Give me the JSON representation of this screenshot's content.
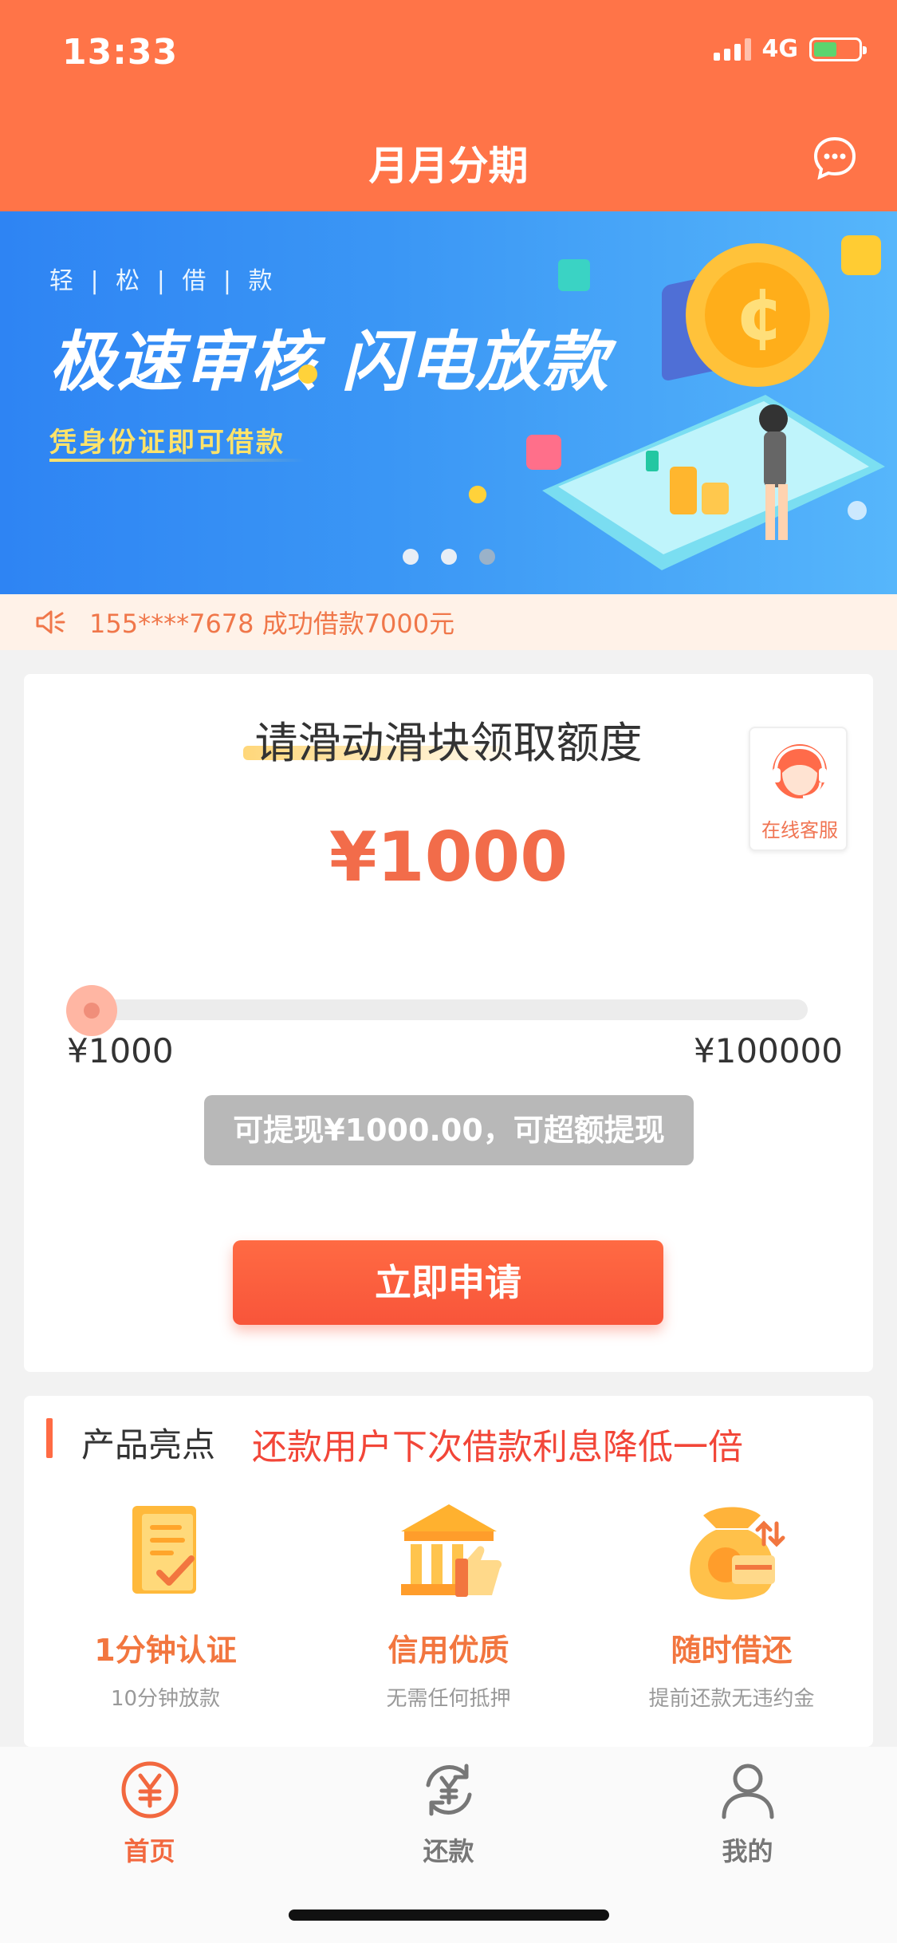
{
  "status_bar": {
    "time": "13:33",
    "network": "4G"
  },
  "header": {
    "title": "月月分期",
    "message_icon": "message-bubble-icon"
  },
  "banner": {
    "tag": "轻 | 松 | 借 | 款",
    "headline": "极速审核 闪电放款",
    "subline": "凭身份证即可借款",
    "slides": 3,
    "active_slide": 2
  },
  "notice": {
    "icon": "speaker-icon",
    "text": "155****7678 成功借款7000元"
  },
  "limit_card": {
    "title": "请滑动滑块领取额度",
    "service_label": "在线客服",
    "amount": "¥1000",
    "slider": {
      "min_label": "¥1000",
      "max_label": "¥100000",
      "min": 1000,
      "max": 100000,
      "value": 1000
    },
    "hint": "可提现¥1000.00，可超额提现",
    "apply_label": "立即申请"
  },
  "highlights": {
    "heading": "产品亮点",
    "slogan": "还款用户下次借款利息降低一倍",
    "items": [
      {
        "icon": "document-check-icon",
        "title": "1分钟认证",
        "desc": "10分钟放款"
      },
      {
        "icon": "bank-thumb-icon",
        "title": "信用优质",
        "desc": "无需任何抵押"
      },
      {
        "icon": "money-bag-icon",
        "title": "随时借还",
        "desc": "提前还款无违约金"
      }
    ]
  },
  "tabbar": {
    "items": [
      {
        "icon": "yen-circle-icon",
        "label": "首页",
        "active": true
      },
      {
        "icon": "yen-refresh-icon",
        "label": "还款",
        "active": false
      },
      {
        "icon": "person-icon",
        "label": "我的",
        "active": false
      }
    ]
  },
  "colors": {
    "brand": "#ff7448",
    "accent": "#f26c4a",
    "slogan": "#f24638",
    "notice_bg": "#fff2e8"
  }
}
